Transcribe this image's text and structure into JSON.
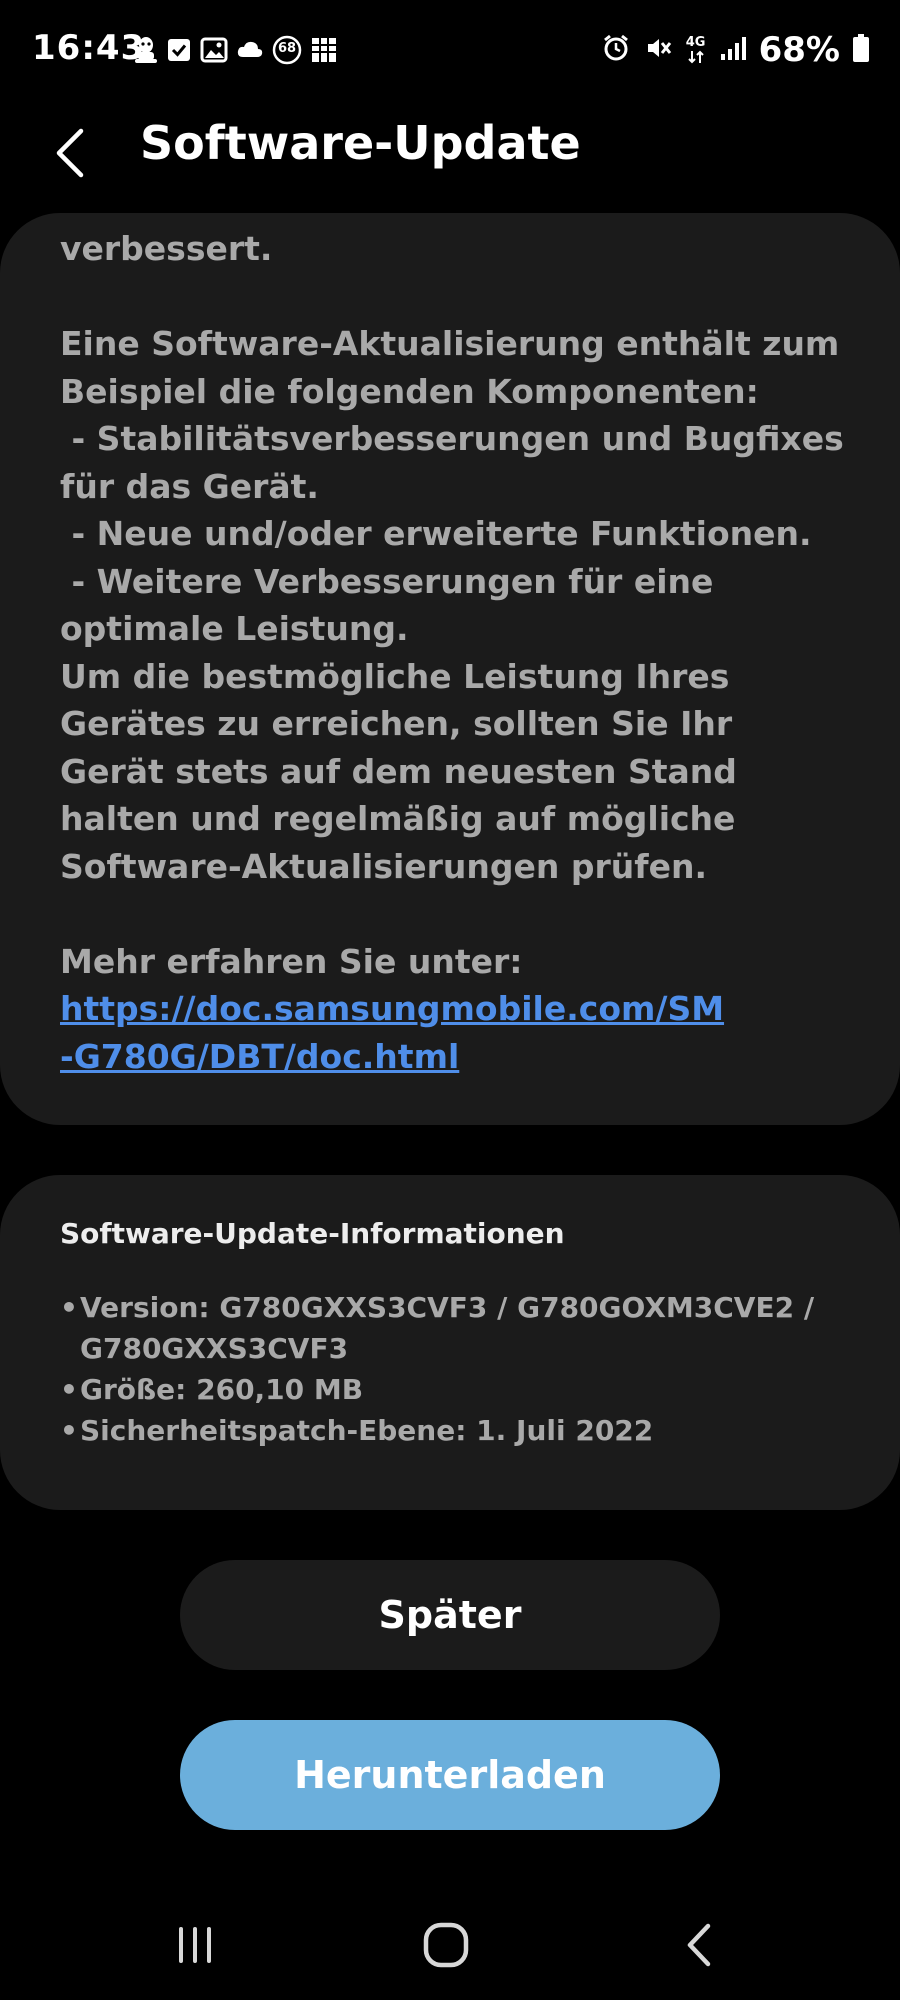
{
  "status_bar": {
    "time": "16:43",
    "notification_icons": [
      "alien-icon",
      "checkbox-icon",
      "gallery-icon",
      "cloud-icon",
      "badge-68-icon",
      "grid-icon"
    ],
    "badge_number": "68",
    "right_icons": [
      "alarm-icon",
      "mute-icon",
      "network-4g-icon",
      "signal-icon",
      "battery-icon"
    ],
    "network_label": "4G",
    "battery_percent": "68%"
  },
  "header": {
    "title": "Software-Update"
  },
  "description": {
    "text_before_link": "verbessert.\n\nEine Software-Aktualisierung enthält zum\nBeispiel die folgenden Komponenten:\n - Stabilitätsverbesserungen und Bugfixes\nfür das Gerät.\n - Neue und/oder erweiterte Funktionen.\n - Weitere Verbesserungen für eine\noptimale Leistung.\nUm die bestmögliche Leistung Ihres\nGerätes zu erreichen, sollten Sie Ihr\nGerät stets auf dem neuesten Stand\nhalten und regelmäßig auf mögliche\nSoftware-Aktualisierungen prüfen.\n\nMehr erfahren Sie unter:\n",
    "link_line1": "https://doc.samsungmobile.com/SM",
    "link_line2": "-G780G/DBT/doc.html"
  },
  "info": {
    "title": "Software-Update-Informationen",
    "version": "Version: G780GXXS3CVF3 / G780GOXM3CVE2 / G780GXXS3CVF3",
    "size": "Größe: 260,10 MB",
    "security_patch": "Sicherheitspatch-Ebene: 1. Juli 2022"
  },
  "buttons": {
    "later_label": "Später",
    "download_label": "Herunterladen"
  },
  "nav_bar": {
    "icons": [
      "recent-apps-icon",
      "home-icon",
      "nav-back-icon"
    ]
  },
  "colors": {
    "background": "#000000",
    "card": "#1b1b1b",
    "body_text": "#a9a9a9",
    "link": "#4f8ee9",
    "primary_button": "#6bafdc"
  }
}
